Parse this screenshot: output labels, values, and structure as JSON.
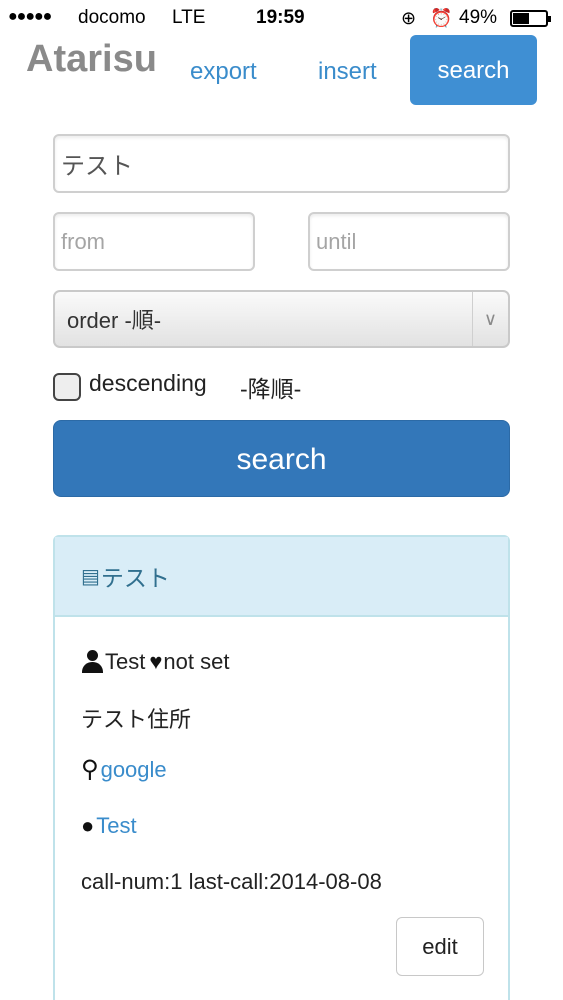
{
  "status_bar": {
    "signal": "●●●●●",
    "carrier": "docomo",
    "network": "LTE",
    "time": "19:59",
    "battery": "49%"
  },
  "nav": {
    "brand": "Atarisu",
    "export_label": "export",
    "insert_label": "insert",
    "search_label": "search"
  },
  "form": {
    "keyword_value": "テスト",
    "from_placeholder": "from",
    "until_placeholder": "until",
    "order_selected": "order -順-",
    "descending_label": "descending",
    "descending_label_ja": "-降順-",
    "search_button": "search"
  },
  "result": {
    "title": "テスト",
    "person": "Test",
    "heart_status": "not set",
    "address": "テスト住所",
    "map_link": "google",
    "web_link": "Test",
    "call_info": "call-num:1 last-call:2014-08-08",
    "edit_label": "edit"
  },
  "colors": {
    "primary": "#3377b9",
    "nav_active": "#3f8fd3",
    "link": "#3a8ccb",
    "panel_heading_bg": "#d9edf7",
    "panel_border": "#bfe2ea"
  }
}
